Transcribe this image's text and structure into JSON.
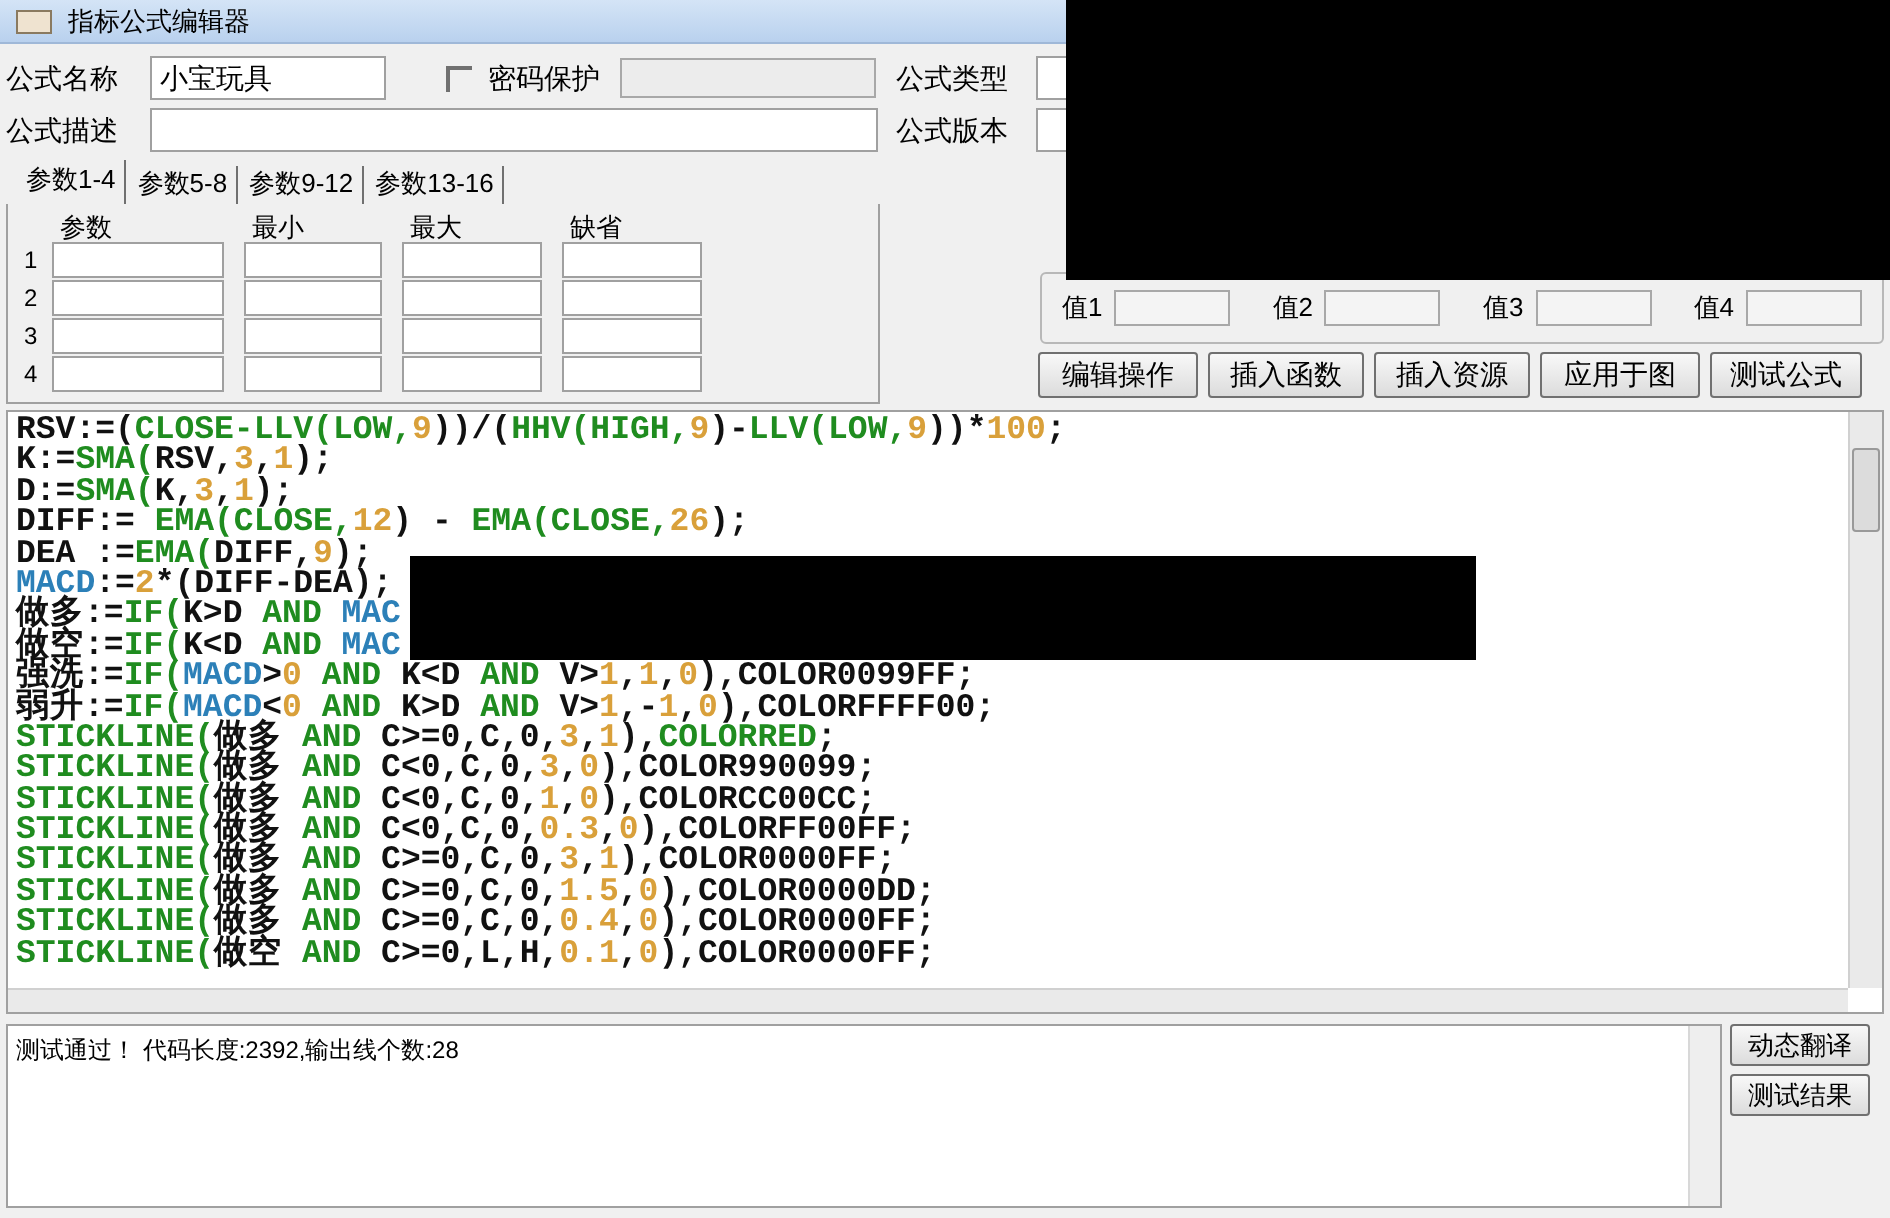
{
  "window": {
    "title": "指标公式编辑器"
  },
  "form": {
    "name_label": "公式名称",
    "name_value": "小宝玩具",
    "password": {
      "label": "密码保护",
      "checked": false
    },
    "description_label": "公式描述",
    "type_label": "公式类型",
    "version_label": "公式版本"
  },
  "param_tabs": [
    {
      "label": "参数1-4",
      "selected": true
    },
    {
      "label": "参数5-8",
      "selected": false
    },
    {
      "label": "参数9-12",
      "selected": false
    },
    {
      "label": "参数13-16",
      "selected": false
    }
  ],
  "param_table": {
    "columns": [
      "参数",
      "最小",
      "最大",
      "缺省"
    ],
    "rows": [
      "1",
      "2",
      "3",
      "4"
    ]
  },
  "values": [
    "值1",
    "值2",
    "值3",
    "值4"
  ],
  "buttons": [
    "编辑操作",
    "插入函数",
    "插入资源",
    "应用于图",
    "测试公式"
  ],
  "code_lines": [
    [
      {
        "text": "RSV:=(",
        "kind": "plain"
      },
      {
        "text": "CLOSE-LLV(LOW,",
        "kind": "func"
      },
      {
        "text": "9",
        "kind": "num"
      },
      {
        "text": "))/(",
        "kind": "plain"
      },
      {
        "text": "HHV(HIGH,",
        "kind": "func"
      },
      {
        "text": "9",
        "kind": "num"
      },
      {
        "text": ")-",
        "kind": "plain"
      },
      {
        "text": "LLV(LOW,",
        "kind": "func"
      },
      {
        "text": "9",
        "kind": "num"
      },
      {
        "text": "))*",
        "kind": "plain"
      },
      {
        "text": "100",
        "kind": "num"
      },
      {
        "text": ";",
        "kind": "plain"
      }
    ],
    [
      {
        "text": "K:=",
        "kind": "plain"
      },
      {
        "text": "SMA(",
        "kind": "func"
      },
      {
        "text": "RSV,",
        "kind": "plain"
      },
      {
        "text": "3",
        "kind": "num"
      },
      {
        "text": ",",
        "kind": "plain"
      },
      {
        "text": "1",
        "kind": "num"
      },
      {
        "text": ");",
        "kind": "plain"
      }
    ],
    [
      {
        "text": "D:=",
        "kind": "plain"
      },
      {
        "text": "SMA(",
        "kind": "func"
      },
      {
        "text": "K,",
        "kind": "plain"
      },
      {
        "text": "3",
        "kind": "num"
      },
      {
        "text": ",",
        "kind": "plain"
      },
      {
        "text": "1",
        "kind": "num"
      },
      {
        "text": ");",
        "kind": "plain"
      }
    ],
    [
      {
        "text": "DIFF:= ",
        "kind": "plain"
      },
      {
        "text": "EMA(CLOSE,",
        "kind": "func"
      },
      {
        "text": "12",
        "kind": "num"
      },
      {
        "text": ") - ",
        "kind": "plain"
      },
      {
        "text": "EMA(CLOSE,",
        "kind": "func"
      },
      {
        "text": "26",
        "kind": "num"
      },
      {
        "text": ");",
        "kind": "plain"
      }
    ],
    [
      {
        "text": "DEA :=",
        "kind": "plain"
      },
      {
        "text": "EMA(",
        "kind": "func"
      },
      {
        "text": "DIFF,",
        "kind": "plain"
      },
      {
        "text": "9",
        "kind": "num"
      },
      {
        "text": ");",
        "kind": "plain"
      }
    ],
    [
      {
        "text": "MACD",
        "kind": "var"
      },
      {
        "text": ":=",
        "kind": "plain"
      },
      {
        "text": "2",
        "kind": "num"
      },
      {
        "text": "*(DIFF-DEA);",
        "kind": "plain"
      }
    ],
    [
      {
        "text": "做多:=",
        "kind": "plain"
      },
      {
        "text": "IF(",
        "kind": "func"
      },
      {
        "text": "K>D ",
        "kind": "plain"
      },
      {
        "text": "AND ",
        "kind": "func"
      },
      {
        "text": "MAC",
        "kind": "var"
      }
    ],
    [
      {
        "text": "做空:=",
        "kind": "plain"
      },
      {
        "text": "IF(",
        "kind": "func"
      },
      {
        "text": "K<D ",
        "kind": "plain"
      },
      {
        "text": "AND ",
        "kind": "func"
      },
      {
        "text": "MAC",
        "kind": "var"
      }
    ],
    [
      {
        "text": "强洗:=",
        "kind": "plain"
      },
      {
        "text": "IF(",
        "kind": "func"
      },
      {
        "text": "MACD",
        "kind": "var"
      },
      {
        "text": ">",
        "kind": "plain"
      },
      {
        "text": "0",
        "kind": "num"
      },
      {
        "text": " AND ",
        "kind": "func"
      },
      {
        "text": "K<D ",
        "kind": "plain"
      },
      {
        "text": "AND ",
        "kind": "func"
      },
      {
        "text": "V>",
        "kind": "plain"
      },
      {
        "text": "1",
        "kind": "num"
      },
      {
        "text": ",",
        "kind": "plain"
      },
      {
        "text": "1",
        "kind": "num"
      },
      {
        "text": ",",
        "kind": "plain"
      },
      {
        "text": "0",
        "kind": "num"
      },
      {
        "text": "),COLOR0099FF;",
        "kind": "plain"
      }
    ],
    [
      {
        "text": "弱升:=",
        "kind": "plain"
      },
      {
        "text": "IF(",
        "kind": "func"
      },
      {
        "text": "MACD",
        "kind": "var"
      },
      {
        "text": "<",
        "kind": "plain"
      },
      {
        "text": "0",
        "kind": "num"
      },
      {
        "text": " AND ",
        "kind": "func"
      },
      {
        "text": "K>D ",
        "kind": "plain"
      },
      {
        "text": "AND ",
        "kind": "func"
      },
      {
        "text": "V>",
        "kind": "plain"
      },
      {
        "text": "1",
        "kind": "num"
      },
      {
        "text": ",-",
        "kind": "plain"
      },
      {
        "text": "1",
        "kind": "num"
      },
      {
        "text": ",",
        "kind": "plain"
      },
      {
        "text": "0",
        "kind": "num"
      },
      {
        "text": "),COLORFFFF00;",
        "kind": "plain"
      }
    ],
    [
      {
        "text": "STICKLINE(",
        "kind": "func"
      },
      {
        "text": "做多 ",
        "kind": "plain"
      },
      {
        "text": "AND ",
        "kind": "func"
      },
      {
        "text": "C>=0,C,0,",
        "kind": "plain"
      },
      {
        "text": "3",
        "kind": "num"
      },
      {
        "text": ",",
        "kind": "plain"
      },
      {
        "text": "1",
        "kind": "num"
      },
      {
        "text": "),",
        "kind": "plain"
      },
      {
        "text": "COLORRED",
        "kind": "func"
      },
      {
        "text": ";",
        "kind": "plain"
      }
    ],
    [
      {
        "text": "STICKLINE(",
        "kind": "func"
      },
      {
        "text": "做多 ",
        "kind": "plain"
      },
      {
        "text": "AND ",
        "kind": "func"
      },
      {
        "text": "C<0,C,0,",
        "kind": "plain"
      },
      {
        "text": "3",
        "kind": "num"
      },
      {
        "text": ",",
        "kind": "plain"
      },
      {
        "text": "0",
        "kind": "num"
      },
      {
        "text": "),COLOR990099;",
        "kind": "plain"
      }
    ],
    [
      {
        "text": "STICKLINE(",
        "kind": "func"
      },
      {
        "text": "做多 ",
        "kind": "plain"
      },
      {
        "text": "AND ",
        "kind": "func"
      },
      {
        "text": "C<0,C,0,",
        "kind": "plain"
      },
      {
        "text": "1",
        "kind": "num"
      },
      {
        "text": ",",
        "kind": "plain"
      },
      {
        "text": "0",
        "kind": "num"
      },
      {
        "text": "),COLORCC00CC;",
        "kind": "plain"
      }
    ],
    [
      {
        "text": "STICKLINE(",
        "kind": "func"
      },
      {
        "text": "做多 ",
        "kind": "plain"
      },
      {
        "text": "AND ",
        "kind": "func"
      },
      {
        "text": "C<0,C,0,",
        "kind": "plain"
      },
      {
        "text": "0.3",
        "kind": "num"
      },
      {
        "text": ",",
        "kind": "plain"
      },
      {
        "text": "0",
        "kind": "num"
      },
      {
        "text": "),COLORFF00FF;",
        "kind": "plain"
      }
    ],
    [
      {
        "text": "STICKLINE(",
        "kind": "func"
      },
      {
        "text": "做多 ",
        "kind": "plain"
      },
      {
        "text": "AND ",
        "kind": "func"
      },
      {
        "text": "C>=0,C,0,",
        "kind": "plain"
      },
      {
        "text": "3",
        "kind": "num"
      },
      {
        "text": ",",
        "kind": "plain"
      },
      {
        "text": "1",
        "kind": "num"
      },
      {
        "text": "),COLOR0000FF;",
        "kind": "plain"
      }
    ],
    [
      {
        "text": "STICKLINE(",
        "kind": "func"
      },
      {
        "text": "做多 ",
        "kind": "plain"
      },
      {
        "text": "AND ",
        "kind": "func"
      },
      {
        "text": "C>=0,C,0,",
        "kind": "plain"
      },
      {
        "text": "1.5",
        "kind": "num"
      },
      {
        "text": ",",
        "kind": "plain"
      },
      {
        "text": "0",
        "kind": "num"
      },
      {
        "text": "),COLOR0000DD;",
        "kind": "plain"
      }
    ],
    [
      {
        "text": "STICKLINE(",
        "kind": "func"
      },
      {
        "text": "做多 ",
        "kind": "plain"
      },
      {
        "text": "AND ",
        "kind": "func"
      },
      {
        "text": "C>=0,C,0,",
        "kind": "plain"
      },
      {
        "text": "0.4",
        "kind": "num"
      },
      {
        "text": ",",
        "kind": "plain"
      },
      {
        "text": "0",
        "kind": "num"
      },
      {
        "text": "),COLOR0000FF;",
        "kind": "plain"
      }
    ],
    [
      {
        "text": "STICKLINE(",
        "kind": "func"
      },
      {
        "text": "做空 ",
        "kind": "plain"
      },
      {
        "text": "AND ",
        "kind": "func"
      },
      {
        "text": "C>=0,L,H,",
        "kind": "plain"
      },
      {
        "text": "0.1",
        "kind": "num"
      },
      {
        "text": ",",
        "kind": "plain"
      },
      {
        "text": "0",
        "kind": "num"
      },
      {
        "text": "),COLOR0000FF;",
        "kind": "plain"
      }
    ]
  ],
  "output": {
    "message": "测试通过！ 代码长度:2392,输出线个数:28"
  },
  "side_buttons": [
    "动态翻译",
    "测试结果"
  ]
}
